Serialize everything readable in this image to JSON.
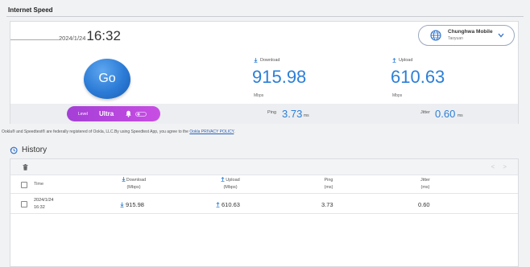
{
  "page": {
    "title": "Internet Speed"
  },
  "test": {
    "date": "2024/1/24",
    "time": "16:32",
    "provider": {
      "name": "Chunghwa Mobile",
      "region": "Taoyuan"
    },
    "go_label": "Go",
    "download": {
      "label": "Download",
      "value": "915.98",
      "unit": "Mbps"
    },
    "upload": {
      "label": "Upload",
      "value": "610.63",
      "unit": "Mbps"
    },
    "level": {
      "label": "Level",
      "value": "Ultra"
    },
    "ping": {
      "label": "Ping",
      "value": "3.73",
      "unit": "ms"
    },
    "jitter": {
      "label": "Jitter",
      "value": "0.60",
      "unit": "ms"
    }
  },
  "disclaimer": {
    "text": "Ookla® and Speedtest® are federally registered of Ookla, LLC.By using Speedtest App, you agree to the ",
    "link": "Ookla PRIVACY POLICY",
    "end": "."
  },
  "history": {
    "title": "History",
    "pager": {
      "prev": "<",
      "next": ">"
    },
    "columns": {
      "time": "Time",
      "download": "Download",
      "download_unit": "(Mbps)",
      "upload": "Upload",
      "upload_unit": "(Mbps)",
      "ping": "Ping",
      "ping_unit": "(ms)",
      "jitter": "Jitter",
      "jitter_unit": "(ms)"
    },
    "rows": [
      {
        "date": "2024/1/24",
        "time": "16:32",
        "download": "915.98",
        "upload": "610.63",
        "ping": "3.73",
        "jitter": "0.60"
      }
    ]
  },
  "colors": {
    "accent": "#2b7fd8",
    "level_pill": "#b847dc",
    "go_button": "#2b7bd6"
  }
}
